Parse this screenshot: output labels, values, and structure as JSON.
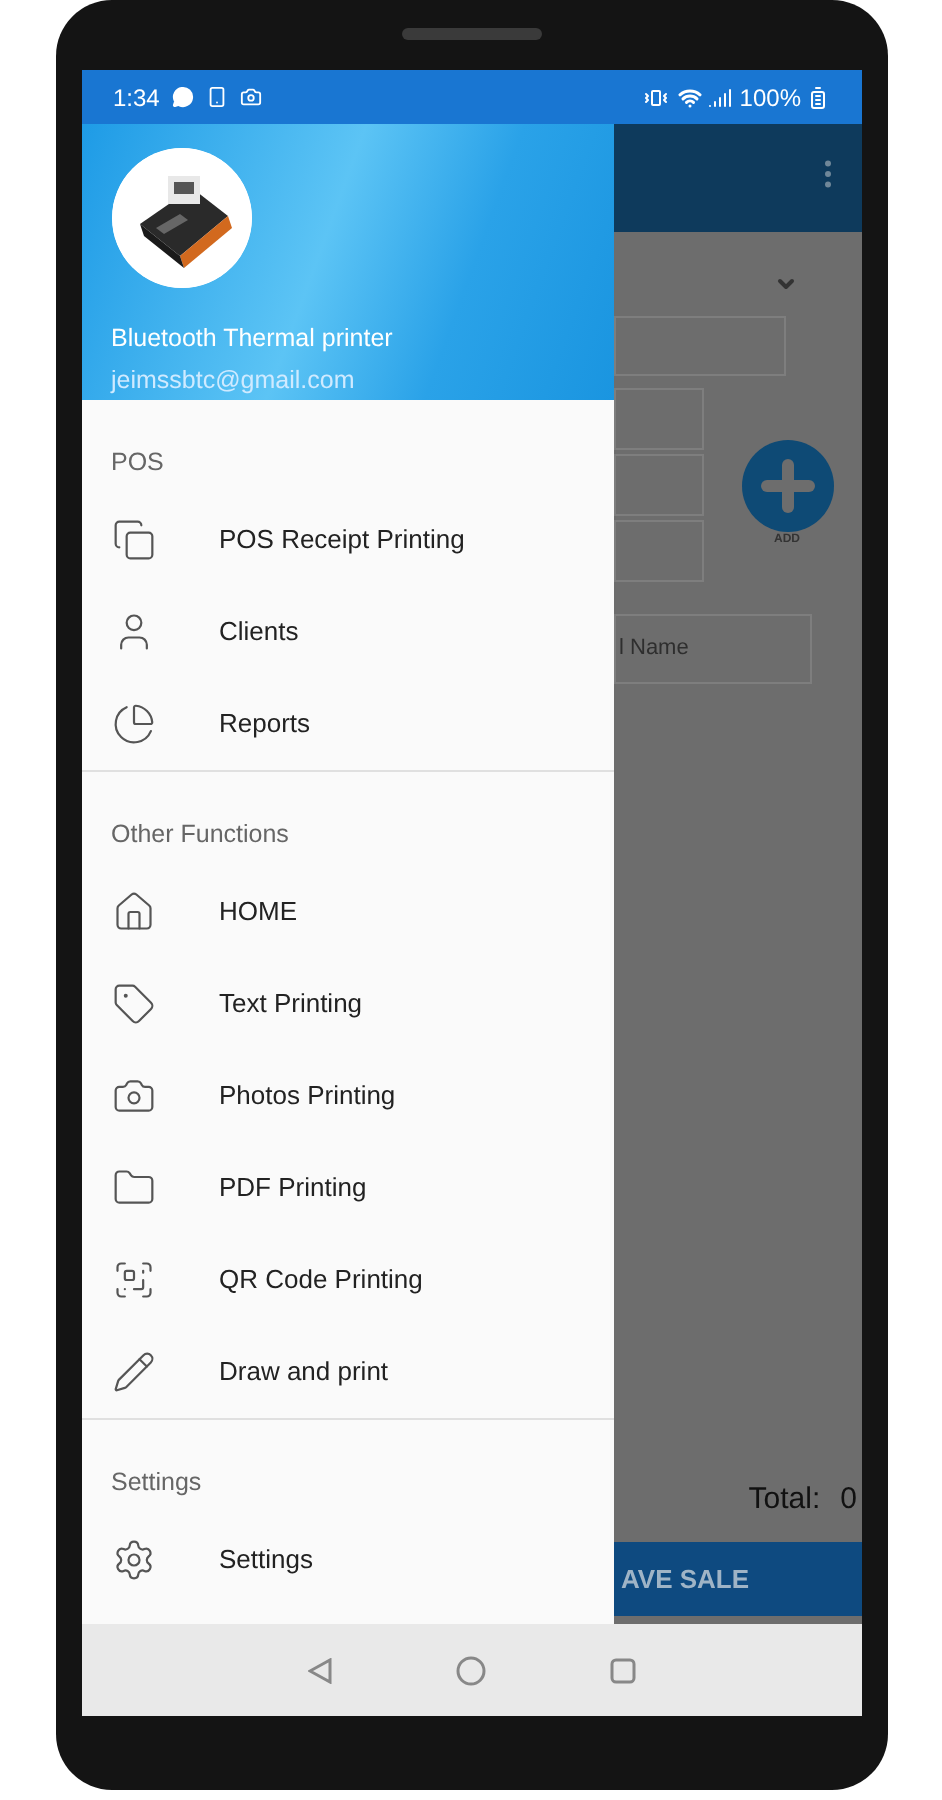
{
  "status_bar": {
    "time": "1:34",
    "battery": "100%"
  },
  "drawer": {
    "header": {
      "title": "Bluetooth Thermal printer",
      "email": "jeimssbtc@gmail.com"
    },
    "sections": [
      {
        "title": "POS",
        "items": [
          {
            "label": "POS Receipt Printing",
            "kind": "receipts"
          },
          {
            "label": "Clients",
            "kind": "clients"
          },
          {
            "label": "Reports",
            "kind": "reports"
          }
        ]
      },
      {
        "title": "Other Functions",
        "items": [
          {
            "label": "HOME",
            "kind": "home"
          },
          {
            "label": "Text Printing",
            "kind": "text"
          },
          {
            "label": "Photos Printing",
            "kind": "photos"
          },
          {
            "label": "PDF Printing",
            "kind": "pdf"
          },
          {
            "label": "QR Code Printing",
            "kind": "qr"
          },
          {
            "label": "Draw and print",
            "kind": "draw"
          }
        ]
      },
      {
        "title": "Settings",
        "items": [
          {
            "label": "Settings",
            "kind": "settings"
          }
        ]
      }
    ]
  },
  "background_screen": {
    "name_placeholder": "l Name",
    "add_label": "ADD",
    "total_label": "Total:",
    "total_value": "0",
    "save_button": "AVE SALE"
  }
}
